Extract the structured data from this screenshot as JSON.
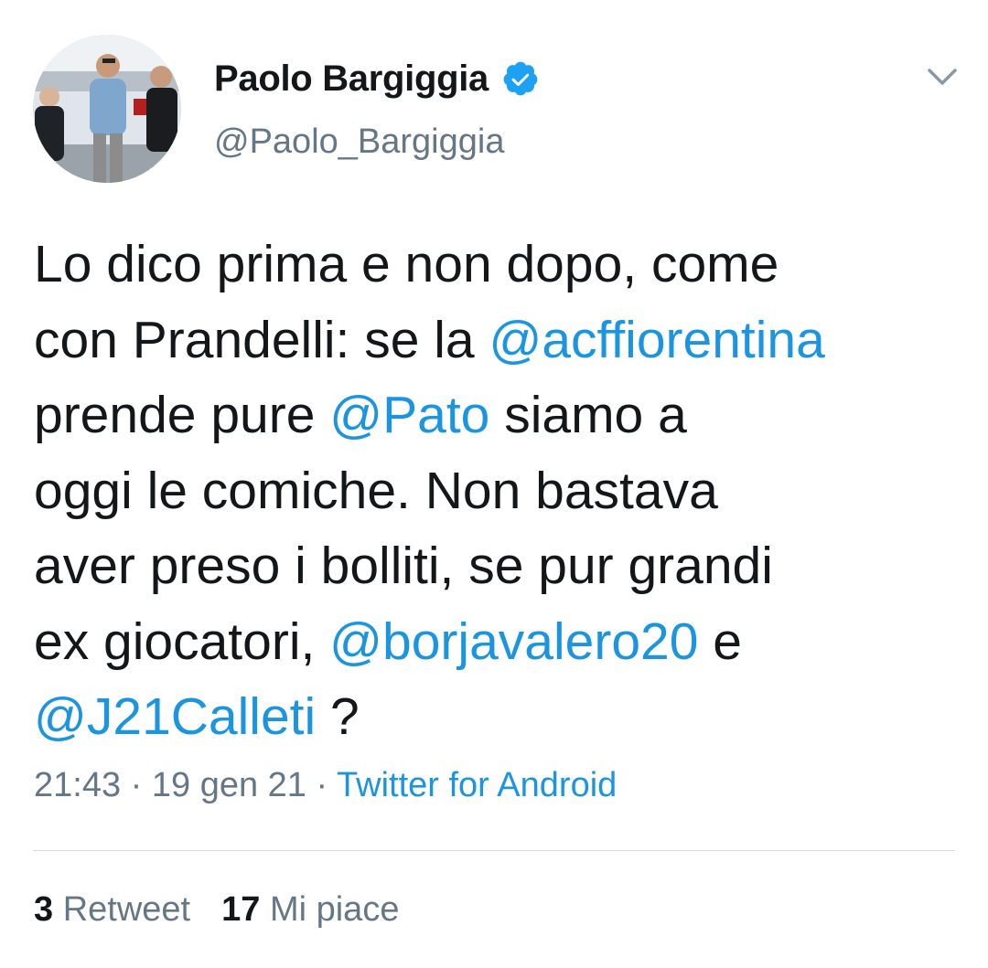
{
  "author": {
    "name": "Paolo Bargiggia",
    "handle": "@Paolo_Bargiggia",
    "verified_icon": "verified-badge-icon"
  },
  "tweet": {
    "lines": [
      [
        {
          "t": "Lo dico prima e non dopo, come",
          "m": false
        }
      ],
      [
        {
          "t": "con Prandelli: se la ",
          "m": false
        },
        {
          "t": "@acffiorentina",
          "m": true
        }
      ],
      [
        {
          "t": "prende pure ",
          "m": false
        },
        {
          "t": "@Pato",
          "m": true
        },
        {
          "t": " siamo a",
          "m": false
        }
      ],
      [
        {
          "t": "oggi le comiche. Non bastava",
          "m": false
        }
      ],
      [
        {
          "t": "aver preso i bolliti, se pur grandi",
          "m": false
        }
      ],
      [
        {
          "t": "ex giocatori, ",
          "m": false
        },
        {
          "t": "@borjavalero20",
          "m": true
        },
        {
          "t": " e",
          "m": false
        }
      ],
      [
        {
          "t": "@J21Calleti",
          "m": true
        },
        {
          "t": " ?",
          "m": false
        }
      ]
    ]
  },
  "meta": {
    "time": "21:43",
    "date": "19 gen 21",
    "separator": " · ",
    "source": "Twitter for Android"
  },
  "stats": {
    "retweets_count": "3",
    "retweets_label": "Retweet",
    "likes_count": "17",
    "likes_label": "Mi piace"
  },
  "colors": {
    "accent": "#1b95e0",
    "text": "#14171a",
    "muted": "#657786",
    "divider": "#d8dde1"
  }
}
